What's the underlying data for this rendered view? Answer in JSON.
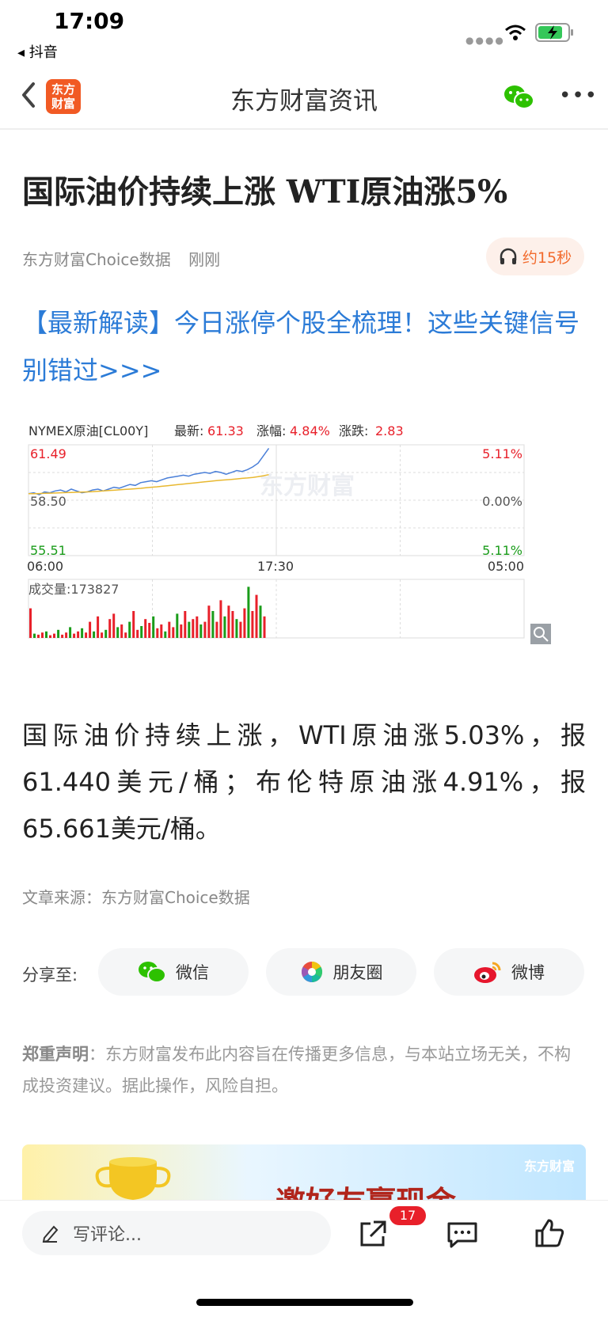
{
  "status_bar": {
    "time": "17:09",
    "back_app": "◂ 抖音"
  },
  "nav": {
    "logo_line1": "东方",
    "logo_line2": "财富",
    "title": "东方财富资讯",
    "more": "•••"
  },
  "article": {
    "title": "国际油价持续上涨 WTI原油涨5%",
    "author": "东方财富Choice数据",
    "time": "刚刚",
    "listen_label": "约15秒",
    "promo_link": "【最新解读】今日涨停个股全梳理！这些关键信号别错过>>>",
    "body": "国际油价持续上涨，WTI原油涨5.03%，报61.440美元/桶；布伦特原油涨4.91%，报65.661美元/桶。",
    "source": "文章来源：东方财富Choice数据",
    "disclaimer_bold": "郑重声明",
    "disclaimer": "：东方财富发布此内容旨在传播更多信息，与本站立场无关，不构成投资建议。据此操作，风险自担。"
  },
  "share": {
    "label": "分享至:",
    "wechat": "微信",
    "moments": "朋友圈",
    "weibo": "微博"
  },
  "banner": {
    "logo": "东方财富",
    "text": "邀好友赢现金"
  },
  "bottom": {
    "comment_placeholder": "写评论...",
    "badge": "17"
  },
  "chart_data": {
    "type": "line",
    "symbol": "NYMEX原油[CL00Y]",
    "latest_label": "最新:",
    "latest": "61.33",
    "change_pct_label": "涨幅:",
    "change_pct": "4.84%",
    "change_label": "涨跌:",
    "change": "2.83",
    "y_ticks_left": [
      "61.49",
      "58.50",
      "55.51"
    ],
    "y_ticks_right": [
      "5.11%",
      "0.00%",
      "5.11%"
    ],
    "x_ticks": [
      "06:00",
      "17:30",
      "05:00"
    ],
    "ylim": [
      55.51,
      61.49
    ],
    "watermark": "东方财富",
    "volume_label": "成交量:173827",
    "series": [
      {
        "name": "price",
        "color": "#4a7fd8",
        "values": [
          58.85,
          58.9,
          58.8,
          58.95,
          58.9,
          59.0,
          59.05,
          58.95,
          59.1,
          59.0,
          58.9,
          58.95,
          59.05,
          59.1,
          59.0,
          59.1,
          59.2,
          59.15,
          59.25,
          59.35,
          59.3,
          59.45,
          59.5,
          59.55,
          59.5,
          59.6,
          59.7,
          59.75,
          59.8,
          59.85,
          59.8,
          59.9,
          59.95,
          60.0,
          59.95,
          60.05,
          60.0,
          59.9,
          60.0,
          60.1,
          60.05,
          60.15,
          60.3,
          60.5,
          60.9,
          61.3
        ]
      },
      {
        "name": "avg",
        "color": "#e8b830",
        "values": [
          58.85,
          58.85,
          58.86,
          58.87,
          58.88,
          58.89,
          58.9,
          58.91,
          58.92,
          58.93,
          58.94,
          58.95,
          58.96,
          58.98,
          59.0,
          59.02,
          59.04,
          59.06,
          59.08,
          59.1,
          59.12,
          59.14,
          59.17,
          59.2,
          59.22,
          59.25,
          59.28,
          59.31,
          59.34,
          59.37,
          59.4,
          59.43,
          59.46,
          59.49,
          59.52,
          59.55,
          59.58,
          59.6,
          59.62,
          59.65,
          59.68,
          59.7,
          59.73,
          59.77,
          59.82,
          59.88
        ]
      }
    ],
    "volume": [
      0.55,
      0.08,
      0.06,
      0.1,
      0.12,
      0.05,
      0.08,
      0.15,
      0.06,
      0.1,
      0.2,
      0.08,
      0.12,
      0.18,
      0.1,
      0.3,
      0.12,
      0.4,
      0.1,
      0.15,
      0.35,
      0.45,
      0.2,
      0.25,
      0.1,
      0.3,
      0.5,
      0.15,
      0.22,
      0.35,
      0.28,
      0.4,
      0.18,
      0.25,
      0.12,
      0.3,
      0.2,
      0.45,
      0.25,
      0.5,
      0.3,
      0.35,
      0.4,
      0.25,
      0.3,
      0.6,
      0.5,
      0.3,
      0.7,
      0.4,
      0.6,
      0.5,
      0.35,
      0.3,
      0.55,
      0.95,
      0.5,
      0.8,
      0.6,
      0.4
    ],
    "total_slots": 100
  }
}
